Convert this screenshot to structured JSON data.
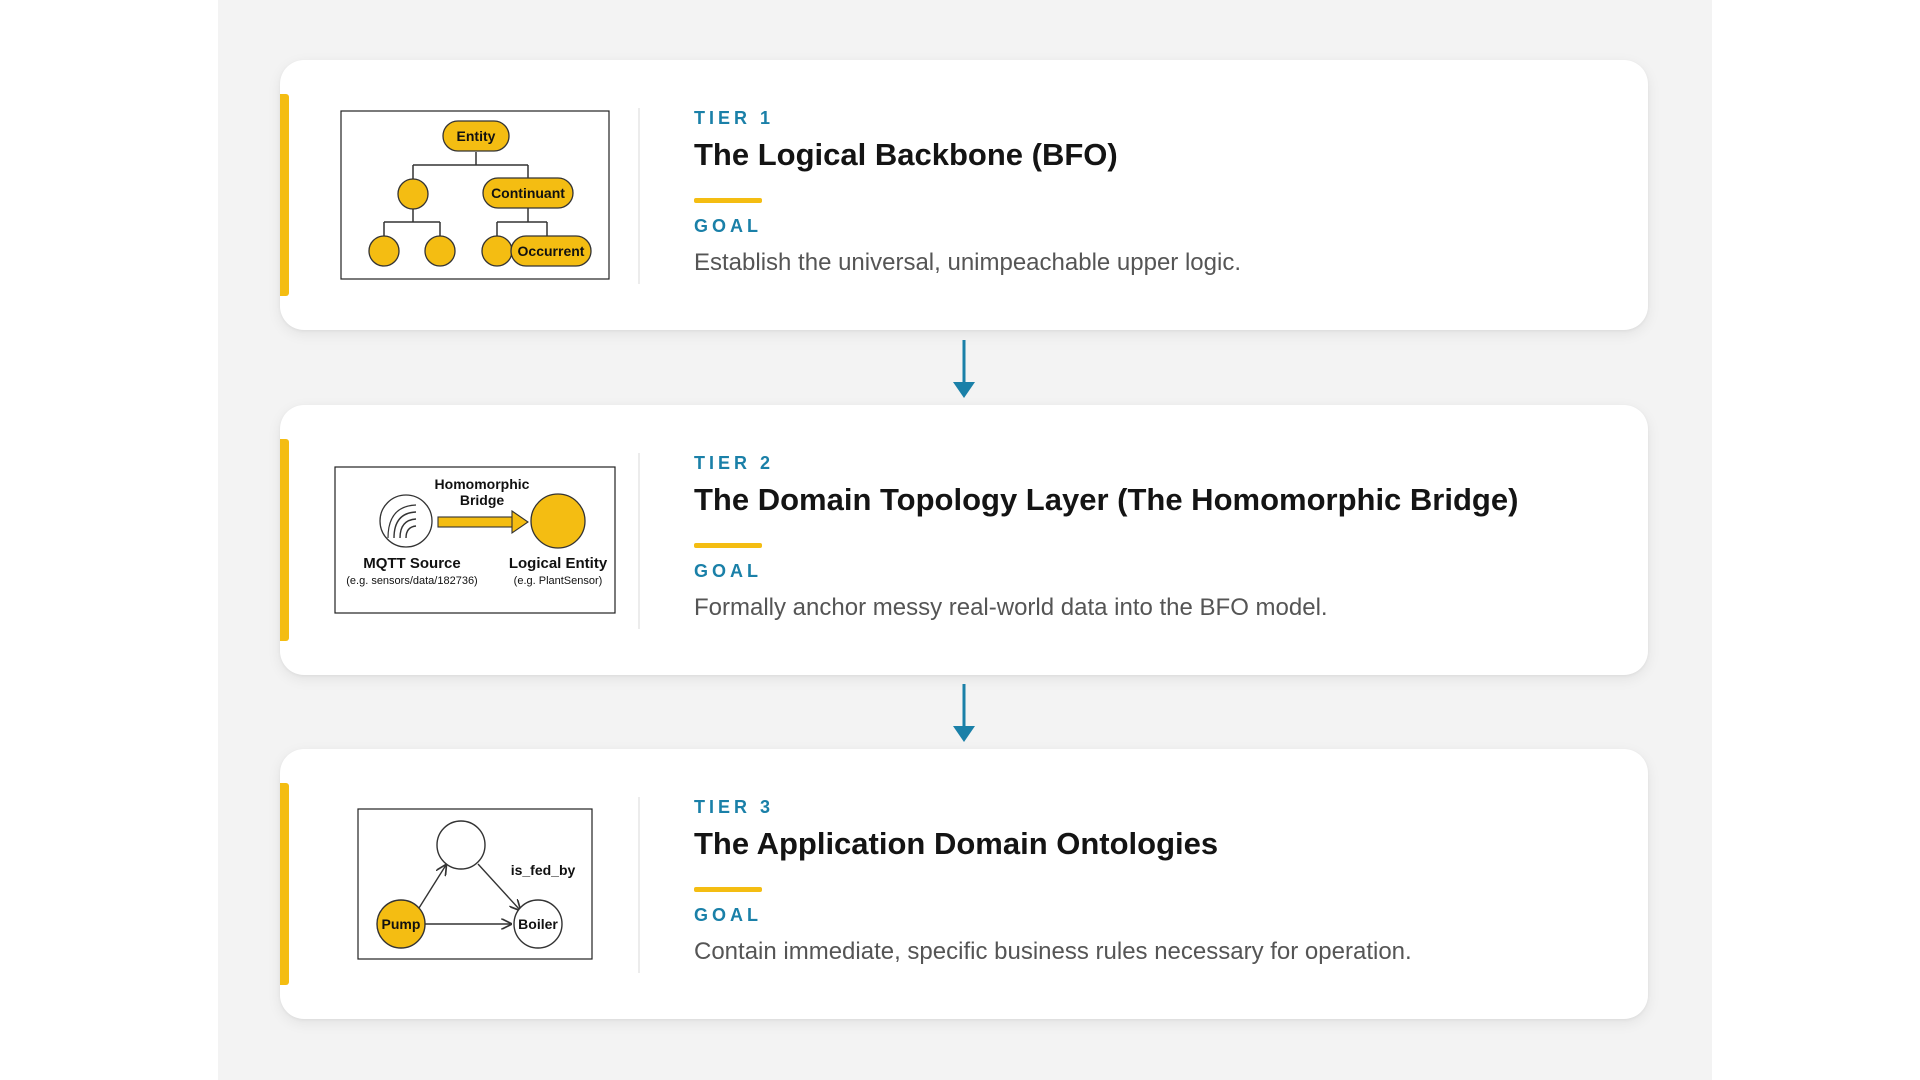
{
  "colors": {
    "accent_yellow": "#f4bd12",
    "tier_blue": "#1a80a8",
    "title": "#141414",
    "description": "#555555",
    "backdrop": "#f3f3f3"
  },
  "tiers": [
    {
      "tier_label": "TIER 1",
      "title": "The Logical Backbone (BFO)",
      "goal_label": "GOAL",
      "goal_text": "Establish the universal, unimpeachable upper logic.",
      "illustration": {
        "nodes": {
          "root": "Entity",
          "mid": "Continuant",
          "leaf": "Occurrent"
        }
      }
    },
    {
      "tier_label": "TIER 2",
      "title": "The Domain Topology Layer (The Homomorphic Bridge)",
      "goal_label": "GOAL",
      "goal_text": "Formally anchor messy real-world data into the BFO model.",
      "illustration": {
        "bridge_line1": "Homomorphic",
        "bridge_line2": "Bridge",
        "source_label": "MQTT Source",
        "source_example": "(e.g. sensors/data/182736)",
        "target_label": "Logical Entity",
        "target_example": "(e.g. PlantSensor)",
        "source_icon": "signal-waves-icon"
      }
    },
    {
      "tier_label": "TIER 3",
      "title": "The Application Domain Ontologies",
      "goal_label": "GOAL",
      "goal_text": "Contain immediate, specific business rules necessary for operation.",
      "illustration": {
        "node_pump": "Pump",
        "node_boiler": "Boiler",
        "edge_label": "is_fed_by"
      }
    }
  ],
  "connector_icon": "arrow-down-icon"
}
